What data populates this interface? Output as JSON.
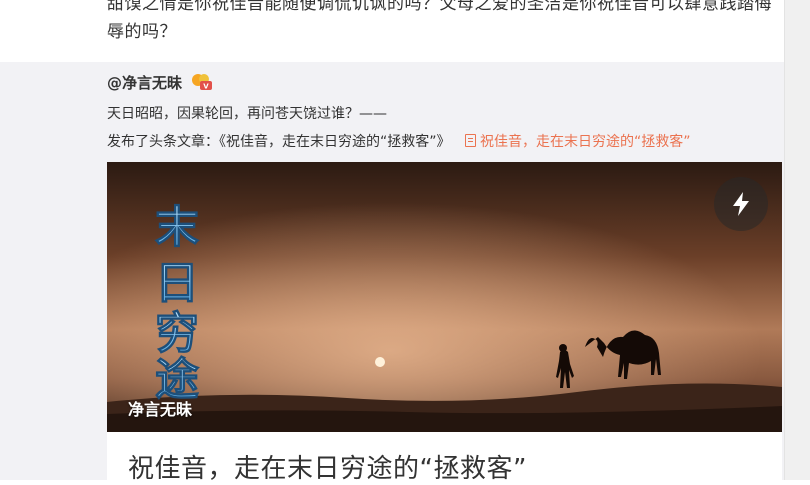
{
  "top_post": {
    "text": "甜馍之情是你祝佳音能随便调侃讥讽的吗？父母之爱的圣洁是你祝佳音可以肆意践踏侮辱的吗？"
  },
  "repost": {
    "author": "@净言无昧",
    "vip_icon": "vip-badge-icon",
    "quote": "天日昭昭，因果轮回，再问苍天饶过谁？——",
    "article_prefix": "发布了头条文章：《祝佳音，走在末日穷途的“拯救客”》",
    "article_link": "祝佳音，走在末日穷途的“拯救客”",
    "article_link_icon": "document-icon"
  },
  "card": {
    "cover_caption": "净言无昧",
    "cover_title_chars": [
      "末",
      "日",
      "穷",
      "途"
    ],
    "flash_icon": "lightning-icon",
    "title": "祝佳音，走在末日穷途的“拯救客”"
  },
  "colors": {
    "link": "#eb7350",
    "repost_bg": "#f2f2f5",
    "text": "#333333"
  }
}
